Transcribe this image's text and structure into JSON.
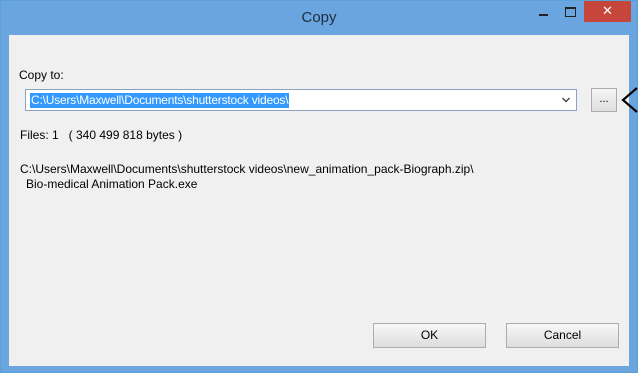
{
  "window": {
    "title": "Copy",
    "close_glyph": "✕",
    "minimize_icon": "minimize-icon",
    "maximize_icon": "maximize-icon"
  },
  "dialog": {
    "copy_to_label": "Copy to:",
    "destination_value": "C:\\Users\\Maxwell\\Documents\\shutterstock videos\\",
    "browse_label": "...",
    "files_summary": "Files: 1   ( 340 499 818 bytes )",
    "source_path": "C:\\Users\\Maxwell\\Documents\\shutterstock videos\\new_animation_pack-Biograph.zip\\",
    "source_file": "Bio-medical Animation Pack.exe",
    "ok_label": "OK",
    "cancel_label": "Cancel"
  },
  "colors": {
    "titlebar": "#6aa5e0",
    "close_button": "#c7463b",
    "selection": "#3399ff"
  }
}
